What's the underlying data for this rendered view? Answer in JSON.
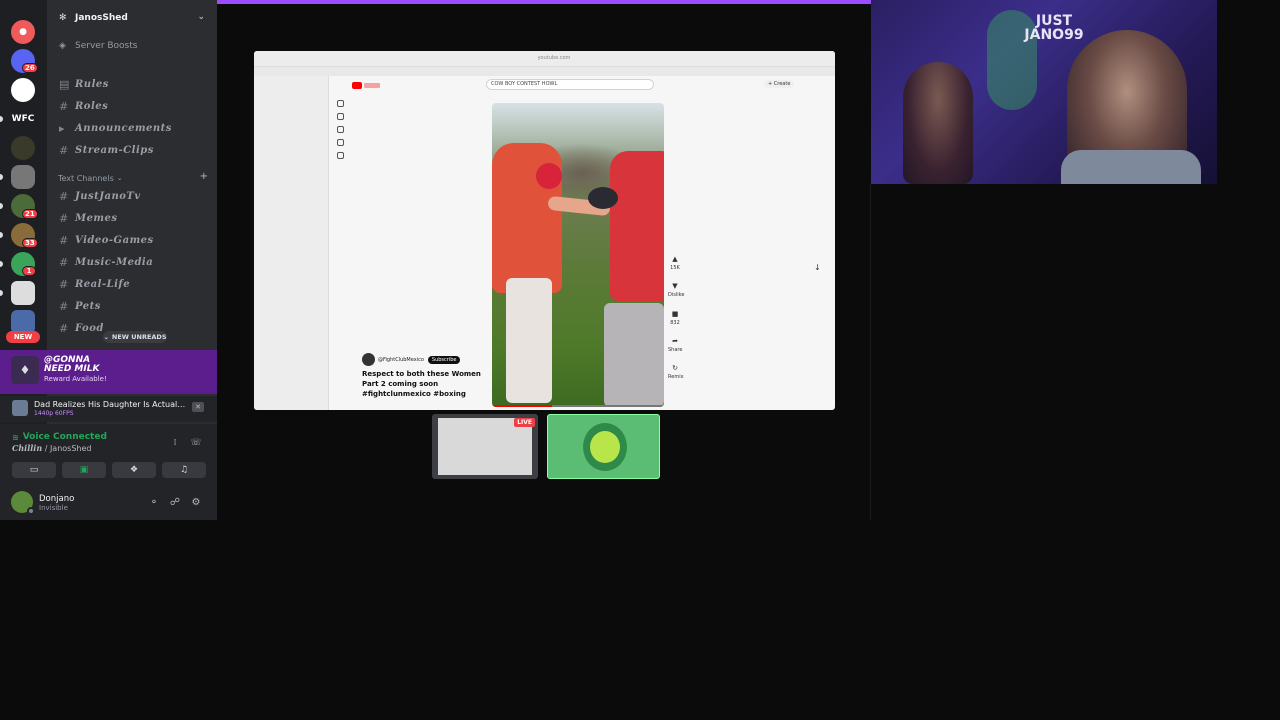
{
  "rail": {
    "servers": [
      {
        "icon": "ghost-icon",
        "color": "#f05a5a",
        "badge": ""
      },
      {
        "icon": "server-icon",
        "color": "#5865f2",
        "badge": "26"
      },
      {
        "icon": "server-icon",
        "color": "#ffffff",
        "badge": ""
      },
      {
        "icon": "text",
        "label": "WFC",
        "color": "#1e1f22",
        "badge": ""
      },
      {
        "icon": "server-icon",
        "color": "#3a3a2a",
        "badge": ""
      },
      {
        "icon": "server-icon",
        "color": "#777777",
        "badge": ""
      },
      {
        "icon": "server-icon",
        "color": "#4b6b3a",
        "badge": "21"
      },
      {
        "icon": "server-icon",
        "color": "#8a6b3a",
        "badge": "33"
      },
      {
        "icon": "server-icon",
        "color": "#3aa55a",
        "badge": "1"
      },
      {
        "icon": "server-icon",
        "color": "#dddddd",
        "badge": ""
      },
      {
        "icon": "server-icon",
        "color": "#4a6aa8",
        "badge": ""
      }
    ],
    "new_label": "NEW"
  },
  "guild": {
    "name": "JanosShed",
    "boosts_label": "Server Boosts"
  },
  "channels_top": [
    {
      "icon": "rules-icon",
      "name": "Rules"
    },
    {
      "icon": "hash-icon",
      "name": "Roles"
    },
    {
      "icon": "megaphone-icon",
      "name": "Announcements"
    },
    {
      "icon": "hash-icon",
      "name": "Stream-Clips"
    }
  ],
  "category": {
    "label": "Text Channels",
    "add": "+"
  },
  "channels_text": [
    {
      "name": "JustJanoTv"
    },
    {
      "name": "Memes"
    },
    {
      "name": "Video-Games"
    },
    {
      "name": "Music-Media"
    },
    {
      "name": "Real-Life"
    },
    {
      "name": "Pets"
    },
    {
      "name": "Food"
    }
  ],
  "new_unreads": "NEW UNREADS",
  "promo": {
    "title_line1": "@GONNA",
    "title_line2": "NEED MILK",
    "subtitle": "Reward Available!"
  },
  "activity": {
    "title": "Dad Realizes His Daughter Is Actually The...",
    "sub": "1440p 60FPS"
  },
  "voice": {
    "status": "Voice Connected",
    "channel": "Chillin",
    "server": "JanosShed"
  },
  "user": {
    "name": "Donjano",
    "status": "Invisible"
  },
  "stream": {
    "url": "youtube.com",
    "search_query": "COW BOY CONTEST HOWL",
    "create_label": "+ Create",
    "channel_name": "@FightClubMexico",
    "subscribe_label": "Subscribe",
    "caption": "Respect to both these Women  Part 2 coming soon #fightclunmexico #boxing",
    "progress": 0.35,
    "side_actions": [
      {
        "icon": "like-icon",
        "label": "15K"
      },
      {
        "icon": "dislike-icon",
        "label": "Dislike"
      },
      {
        "icon": "comment-icon",
        "label": "832"
      },
      {
        "icon": "share-icon",
        "label": "Share"
      },
      {
        "icon": "remix-icon",
        "label": "Remix"
      }
    ]
  },
  "thumbs": {
    "live_label": "LIVE"
  },
  "webcam": {
    "sign_line1": "JUST",
    "sign_line2": "JANO99"
  }
}
